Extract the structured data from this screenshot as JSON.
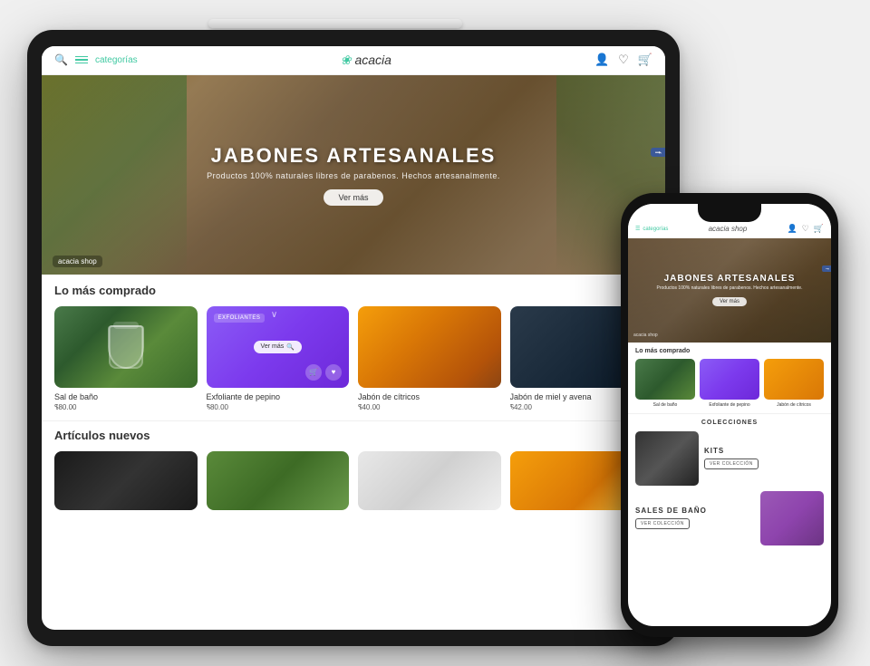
{
  "scene": {
    "bg_color": "#f0f0f0"
  },
  "tablet": {
    "nav": {
      "categorias": "categorías",
      "logo": "acacia",
      "logo_symbol": "❀"
    },
    "hero": {
      "title": "JABONES ARTESANALES",
      "subtitle": "Productos 100% naturales libres de parabenos. Hechos artesanalmente.",
      "btn_label": "Ver más",
      "fb_label": "f",
      "acacia_label": "acacia shop"
    },
    "lo_mas_comprado": {
      "section_title": "Lo más comprado",
      "products": [
        {
          "name": "Sal de baño",
          "price": "$80.00"
        },
        {
          "name": "Exfoliante de pepino",
          "price": "$80.00",
          "badge": "EXFOLIANTES",
          "btn": "Ver más"
        },
        {
          "name": "Jabón de cítricos",
          "price": "$40.00"
        },
        {
          "name": "Jabón de miel y avena",
          "price": "$42.00"
        }
      ]
    },
    "articulos_nuevos": {
      "section_title": "Artículos nuevos"
    }
  },
  "phone": {
    "nav": {
      "categorias": "categorías",
      "logo": "acacia shop"
    },
    "hero": {
      "title": "JABONES ARTESANALES",
      "subtitle": "Productos 100% naturales libres de parabenos. Hechos artesanalmente.",
      "btn_label": "Ver más",
      "fb_label": "f",
      "acacia_label": "acacia shop"
    },
    "lo_mas_comprado": {
      "section_title": "Lo más comprado",
      "products": [
        {
          "name": "Sal de baño"
        },
        {
          "name": "Exfoliante de pepino"
        },
        {
          "name": "Jabón de cítricos"
        }
      ]
    },
    "colecciones": {
      "section_title": "COLECCIONES",
      "kits": {
        "name": "KIts",
        "btn": "VER COLECCIÓN"
      },
      "sales_bano": {
        "name": "SALES DE BAÑO",
        "btn": "VER COLECCIÓN"
      }
    }
  }
}
